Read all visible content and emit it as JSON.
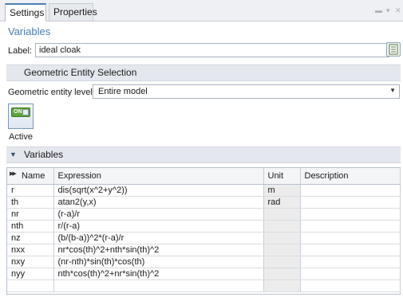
{
  "tabs": [
    {
      "label": "Settings",
      "active": true
    },
    {
      "label": "Properties",
      "active": false
    }
  ],
  "section_title": "Variables",
  "label_field": {
    "caption": "Label:",
    "value": "ideal cloak"
  },
  "geometric_selection": {
    "header": "Geometric Entity Selection",
    "level_caption": "Geometric entity level:",
    "level_value": "Entire model"
  },
  "active_toggle": {
    "state_text": "ON",
    "label": "Active"
  },
  "variables_group": {
    "header": "Variables"
  },
  "table": {
    "columns": [
      "Name",
      "Expression",
      "Unit",
      "Description"
    ],
    "rows": [
      {
        "name": "r",
        "expression": "dis(sqrt(x^2+y^2))",
        "unit": "m",
        "description": ""
      },
      {
        "name": "th",
        "expression": "atan2(y,x)",
        "unit": "rad",
        "description": ""
      },
      {
        "name": "nr",
        "expression": "(r-a)/r",
        "unit": "",
        "description": ""
      },
      {
        "name": "nth",
        "expression": "r/(r-a)",
        "unit": "",
        "description": ""
      },
      {
        "name": "nz",
        "expression": "(b/(b-a))^2*(r-a)/r",
        "unit": "",
        "description": ""
      },
      {
        "name": "nxx",
        "expression": "nr*cos(th)^2+nth*sin(th)^2",
        "unit": "",
        "description": ""
      },
      {
        "name": "nxy",
        "expression": "(nr-nth)*sin(th)*cos(th)",
        "unit": "",
        "description": ""
      },
      {
        "name": "nyy",
        "expression": "nth*cos(th)^2+nr*sin(th)^2",
        "unit": "",
        "description": ""
      },
      {
        "name": "",
        "expression": "",
        "unit": "",
        "description": ""
      }
    ]
  },
  "colors": {
    "accent": "#4a7cab",
    "header_bg": "#e4e8ee",
    "toggle_on": "#5aa63a"
  },
  "icons": {
    "label_button": "table-edit-icon",
    "collapse": "triangle-down-icon",
    "sort": "double-chevron-icon"
  }
}
